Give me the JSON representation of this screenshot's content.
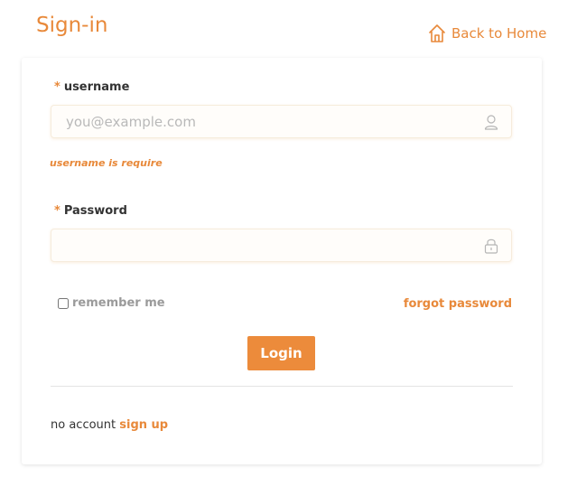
{
  "header": {
    "title": "Sign-in",
    "back_home_label": "Back to Home",
    "back_home_icon": "home-icon"
  },
  "form": {
    "username": {
      "required_mark": "*",
      "label": "username",
      "placeholder": "you@example.com",
      "value": "",
      "icon": "user-icon",
      "error": "username is require"
    },
    "password": {
      "required_mark": "*",
      "label": "Password",
      "placeholder": "",
      "value": "",
      "icon": "lock-icon"
    },
    "remember_me": {
      "label": "remember me",
      "checked": false
    },
    "forgot_password_label": "forgot password",
    "login_label": "Login"
  },
  "footer": {
    "no_account_text": "no account",
    "signup_label": "sign up"
  },
  "colors": {
    "accent": "#e8893a",
    "button": "#ec8b3b"
  }
}
